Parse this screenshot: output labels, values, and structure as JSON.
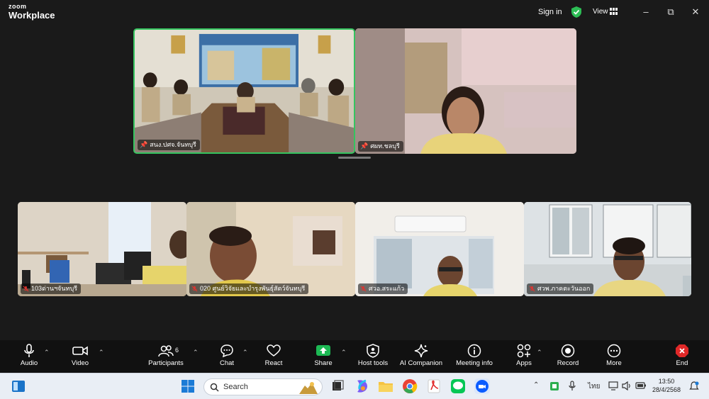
{
  "app": {
    "logo_line1": "zoom",
    "logo_line2": "Workplace",
    "sign_in": "Sign in",
    "view": "View"
  },
  "tiles": [
    {
      "name": "สนง.ปศจ.จันทบุรี",
      "pinned": true,
      "active_speaker": true
    },
    {
      "name": "ศผท.ชลบุรี",
      "pinned": true
    },
    {
      "name": "103ด่านฯจันทบุรี",
      "muted": true
    },
    {
      "name": "020 ศูนย์วิจัยและบำรุงพันธุ์สัตว์จันทบุรี",
      "muted": true
    },
    {
      "name": "ศวอ.สระแก้ว",
      "muted": true
    },
    {
      "name": "ศวพ.ภาคตะวันออก",
      "muted": true
    }
  ],
  "toolbar": {
    "audio": "Audio",
    "video": "Video",
    "participants": "Participants",
    "participants_count": "6",
    "chat": "Chat",
    "react": "React",
    "share": "Share",
    "host_tools": "Host tools",
    "ai_companion": "AI Companion",
    "meeting_info": "Meeting info",
    "apps": "Apps",
    "record": "Record",
    "more": "More",
    "end": "End"
  },
  "taskbar": {
    "search_placeholder": "Search",
    "language": "ไทย",
    "time": "13:50",
    "date": "28/4/2568"
  },
  "colors": {
    "active_border": "#35c45f",
    "share_green": "#1db954",
    "end_red": "#e02828",
    "muted_red": "#e0342f"
  }
}
